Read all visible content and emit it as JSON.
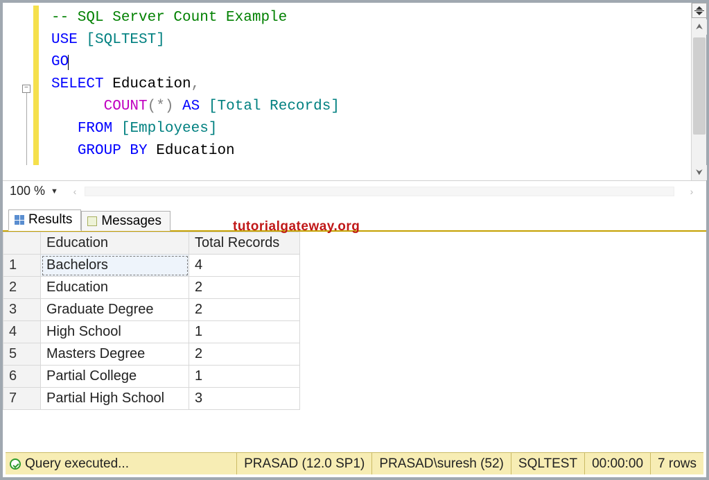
{
  "editor": {
    "comment": "-- SQL Server Count Example",
    "use_kw": "USE",
    "use_arg": "[SQLTEST]",
    "go_kw": "GO",
    "select_kw": "SELECT",
    "select_col": " Education",
    "comma": ",",
    "count_fn": "COUNT",
    "count_lp": "(",
    "count_star": "*",
    "count_rp": ")",
    "as_kw": "AS",
    "alias": "[Total Records]",
    "from_kw": "FROM",
    "from_tbl": "[Employees]",
    "group_kw": "GROUP BY",
    "group_col": " Education"
  },
  "zoom": {
    "value": "100 %"
  },
  "watermark": "tutorialgateway.org",
  "tabs": {
    "results": "Results",
    "messages": "Messages"
  },
  "grid": {
    "headers": {
      "c1": "Education",
      "c2": "Total Records"
    },
    "rows": [
      {
        "n": "1",
        "c1": "Bachelors",
        "c2": "4"
      },
      {
        "n": "2",
        "c1": "Education",
        "c2": "2"
      },
      {
        "n": "3",
        "c1": "Graduate Degree",
        "c2": "2"
      },
      {
        "n": "4",
        "c1": "High School",
        "c2": "1"
      },
      {
        "n": "5",
        "c1": "Masters Degree",
        "c2": "2"
      },
      {
        "n": "6",
        "c1": "Partial College",
        "c2": "1"
      },
      {
        "n": "7",
        "c1": "Partial High School",
        "c2": "3"
      }
    ]
  },
  "status": {
    "exec": "Query executed...",
    "server": "PRASAD (12.0 SP1)",
    "user": "PRASAD\\suresh (52)",
    "db": "SQLTEST",
    "time": "00:00:00",
    "rows": "7 rows"
  }
}
